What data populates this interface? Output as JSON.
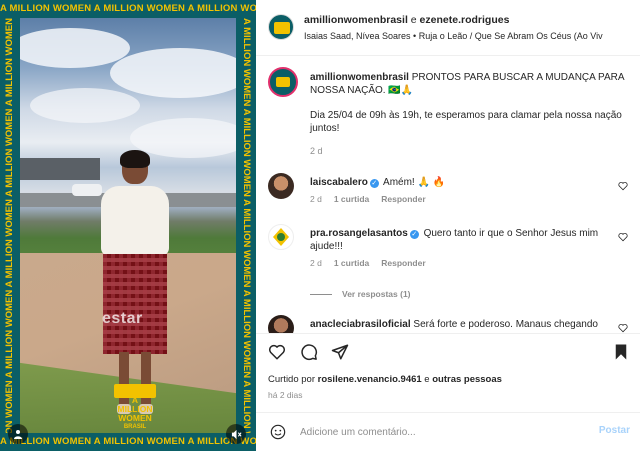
{
  "media": {
    "frame_text": "A MILLION WOMEN A MILLION WOMEN A MILLION WOMEN A MILLION WOMEN A MILLION WOMEN",
    "overlay_word": "estar",
    "logo_line1": "A",
    "logo_line2": "MILLION",
    "logo_line3": "WOMEN",
    "logo_line4": "BRASIL",
    "accent_color": "#f2c200",
    "frame_color": "#0b5e66"
  },
  "header": {
    "user1": "amillionwomenbrasil",
    "connector": " e ",
    "user2": "ezenete.rodrigues",
    "subtitle": "Isaias Saad, Nívea Soares • Ruja o Leão / Que Se Abram Os Céus (Ao Viv"
  },
  "caption": {
    "username": "amillionwomenbrasil",
    "headline": " PRONTOS PARA BUSCAR A MUDANÇA PARA NOSSA NAÇÃO. 🇧🇷🙏",
    "body": "Dia 25/04 de 09h às 19h, te esperamos para clamar pela nossa nação juntos!",
    "time": "2 d"
  },
  "comments": [
    {
      "username": "laiscabalero",
      "verified": true,
      "text": " Amém! 🙏 🔥",
      "time": "2 d",
      "likes": "1 curtida",
      "reply": "Responder"
    },
    {
      "username": "pra.rosangelasantos",
      "verified": true,
      "text": " Quero tanto ir que o Senhor Jesus mim ajude!!!",
      "time": "2 d",
      "likes": "1 curtida",
      "reply": "Responder"
    },
    {
      "username": "anacleciabrasiloficial",
      "verified": false,
      "text": " Será forte e poderoso. Manaus chegando",
      "time": "",
      "likes": "",
      "reply": ""
    }
  ],
  "view_replies": "Ver respostas (1)",
  "likes": {
    "prefix": "Curtido por ",
    "user": "rosilene.venancio.9461",
    "suffix_pre": " e ",
    "suffix": "outras pessoas"
  },
  "date": "há 2 dias",
  "add_comment": {
    "placeholder": "Adicione um comentário...",
    "post_label": "Postar"
  }
}
